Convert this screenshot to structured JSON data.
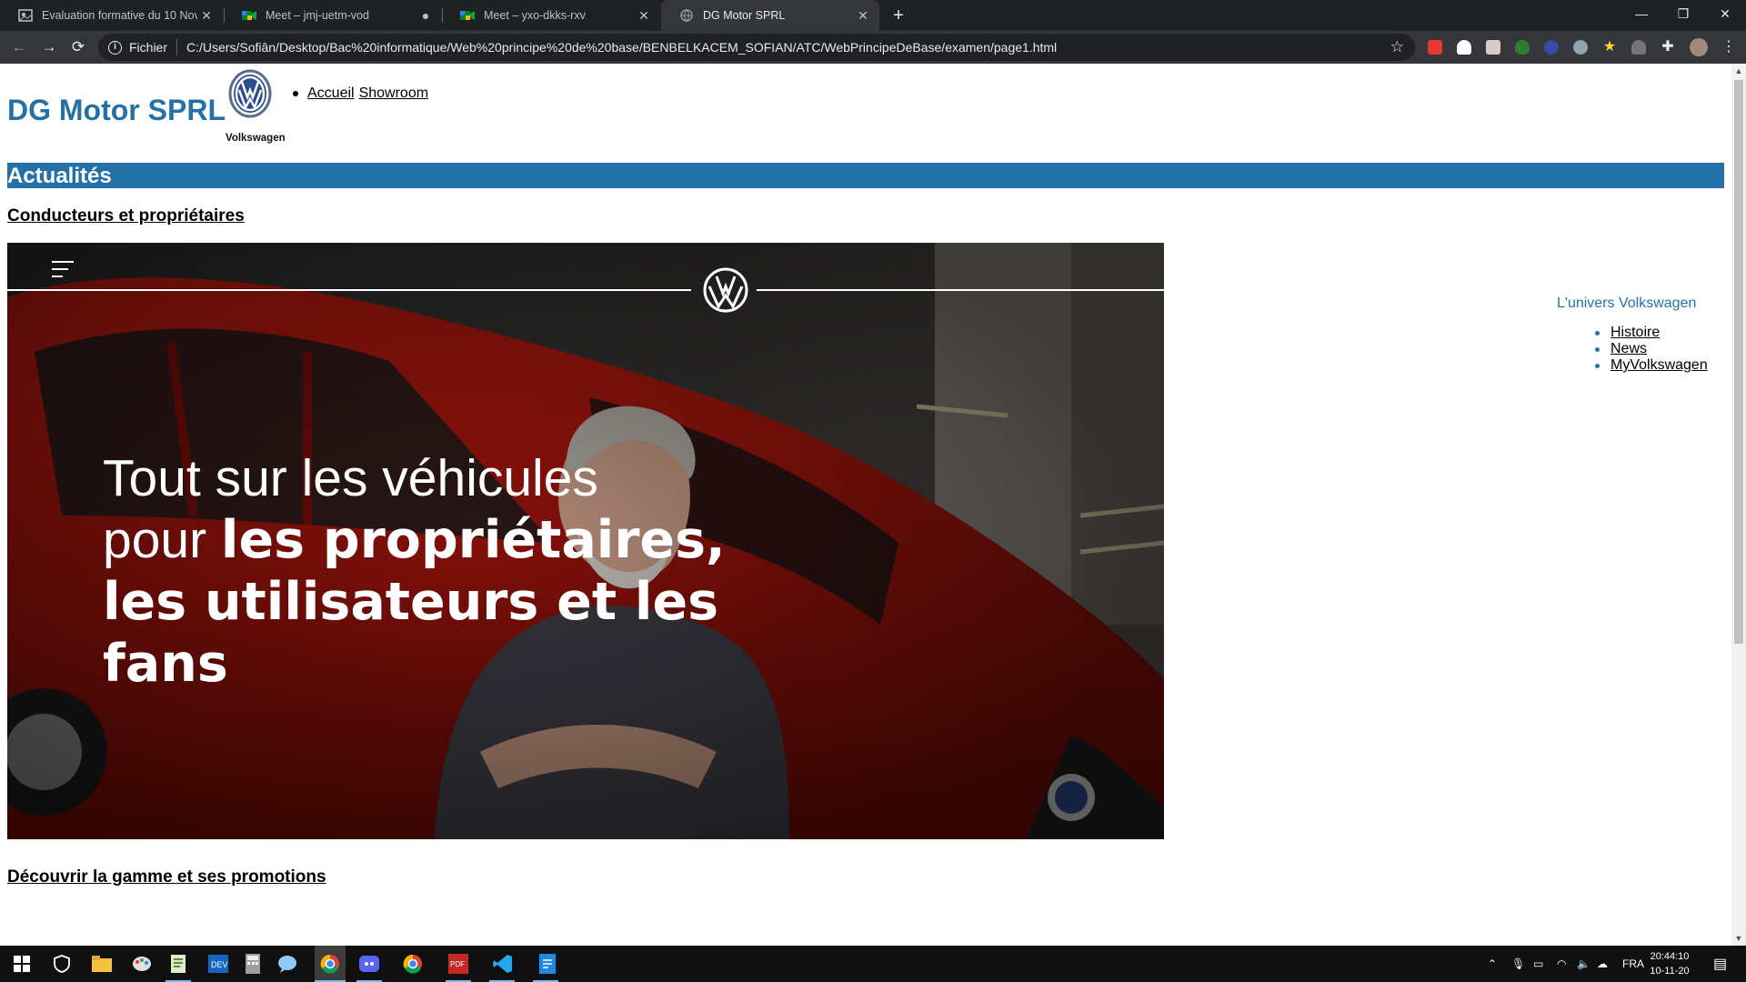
{
  "browser": {
    "tabs": [
      {
        "title": "Evaluation formative du 10 Nove",
        "close": "✕"
      },
      {
        "title": "Meet – jmj-uetm-vod",
        "close": "●"
      },
      {
        "title": "Meet – yxo-dkks-rxv",
        "close": "✕"
      },
      {
        "title": "DG Motor SPRL",
        "close": "✕"
      }
    ],
    "new_tab": "+",
    "window_controls": {
      "minimize": "—",
      "restore": "❐",
      "close": "✕"
    },
    "nav": {
      "back": "←",
      "forward": "→",
      "reload": "⟳"
    },
    "address": {
      "scheme_label": "Fichier",
      "url": "C:/Users/Sofiân/Desktop/Bac%20informatique/Web%20principe%20de%20base/BENBELKACEM_SOFIAN/ATC/WebPrincipeDeBase/examen/page1.html"
    }
  },
  "page": {
    "site_title": "DG Motor SPRL",
    "logo_caption": "Volkswagen",
    "top_nav": [
      "Accueil",
      "Showroom"
    ],
    "section_heading": "Actualités",
    "link_owners": "Conducteurs et propriétaires",
    "hero": {
      "line1": "Tout sur les véhicules",
      "line2_light": "pour ",
      "line2_bold": "les propriétaires,",
      "line3": "les utilisateurs et les",
      "line4": "fans"
    },
    "link_range": "Découvrir la gamme et ses promotions",
    "aside": {
      "title": "L'univers Volkswagen",
      "links": [
        "Histoire",
        "News",
        "MyVolkswagen"
      ]
    }
  },
  "taskbar": {
    "language": "FRA",
    "time": "20:44:10",
    "date": "10-11-20"
  },
  "colors": {
    "brand_blue": "#2471a8",
    "chrome_dark": "#202124",
    "chrome_toolbar": "#35363a"
  }
}
